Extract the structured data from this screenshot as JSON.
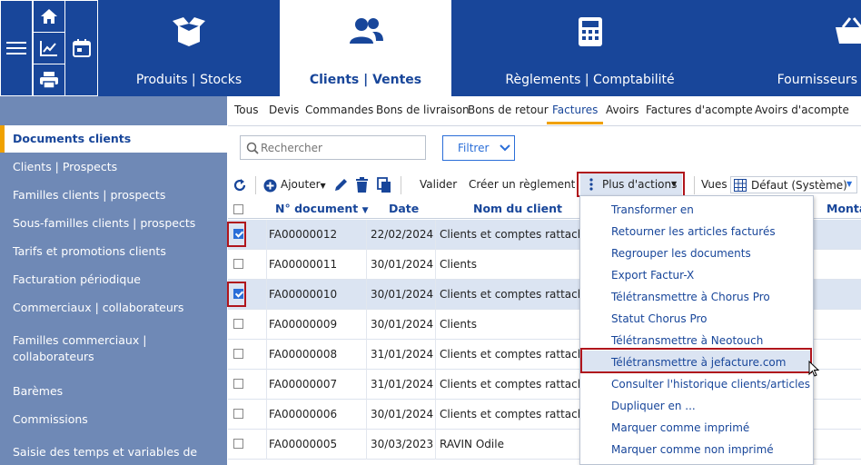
{
  "nav": {
    "tabs": [
      {
        "label": "Produits | Stocks",
        "icon": "box-icon"
      },
      {
        "label": "Clients | Ventes",
        "icon": "users-icon"
      },
      {
        "label": "Règlements | Comptabilité",
        "icon": "calculator-icon"
      },
      {
        "label": "Fournisseurs",
        "icon": "basket-icon"
      }
    ]
  },
  "sidebar": {
    "items": [
      "Documents clients",
      "Clients | Prospects",
      "Familles clients | prospects",
      "Sous-familles clients | prospects",
      "Tarifs et promotions clients",
      "Facturation périodique",
      "Commerciaux | collaborateurs",
      "Familles commerciaux | collaborateurs",
      "Barèmes",
      "Commissions",
      "Saisie des temps et variables de"
    ]
  },
  "doc_tabs": [
    "Tous",
    "Devis",
    "Commandes",
    "Bons de livraison",
    "Bons de retour",
    "Factures",
    "Avoirs",
    "Factures d'acompte",
    "Avoirs d'acompte"
  ],
  "search": {
    "placeholder": "Rechercher"
  },
  "filter": {
    "label": "Filtrer"
  },
  "toolbar": {
    "add": "Ajouter",
    "validate": "Valider",
    "create_payment": "Créer un règlement",
    "more_actions": "Plus d'actions",
    "views": "Vues",
    "view_value": "Défaut (Système)"
  },
  "table": {
    "headers": {
      "doc": "N° document",
      "date": "Date",
      "client": "Nom du client",
      "amount": "Monta"
    },
    "rows": [
      {
        "doc": "FA00000012",
        "date": "22/02/2024",
        "client": "Clients et comptes rattachés",
        "checked": true
      },
      {
        "doc": "FA00000011",
        "date": "30/01/2024",
        "client": "Clients",
        "checked": false
      },
      {
        "doc": "FA00000010",
        "date": "30/01/2024",
        "client": "Clients et comptes rattachés",
        "checked": true
      },
      {
        "doc": "FA00000009",
        "date": "30/01/2024",
        "client": "Clients",
        "checked": false
      },
      {
        "doc": "FA00000008",
        "date": "31/01/2024",
        "client": "Clients et comptes rattachés",
        "checked": false
      },
      {
        "doc": "FA00000007",
        "date": "31/01/2024",
        "client": "Clients et comptes rattachés",
        "checked": false
      },
      {
        "doc": "FA00000006",
        "date": "30/01/2024",
        "client": "Clients et comptes rattachés",
        "checked": false
      },
      {
        "doc": "FA00000005",
        "date": "30/03/2023",
        "client": "RAVIN Odile",
        "checked": false
      }
    ]
  },
  "menu": {
    "items": [
      "Transformer en",
      "Retourner les articles facturés",
      "Regrouper les documents",
      "Export Factur-X",
      "Télétransmettre à Chorus Pro",
      "Statut Chorus Pro",
      "Télétransmettre à Neotouch",
      "Télétransmettre à jefacture.com",
      "Consulter l'historique clients/articles",
      "Dupliquer en ...",
      "Marquer comme imprimé",
      "Marquer comme non imprimé"
    ]
  },
  "colors": {
    "brand": "#18469a",
    "sidebar": "#6f89b6",
    "accent": "#f0a100",
    "highlight": "#b0151c"
  }
}
